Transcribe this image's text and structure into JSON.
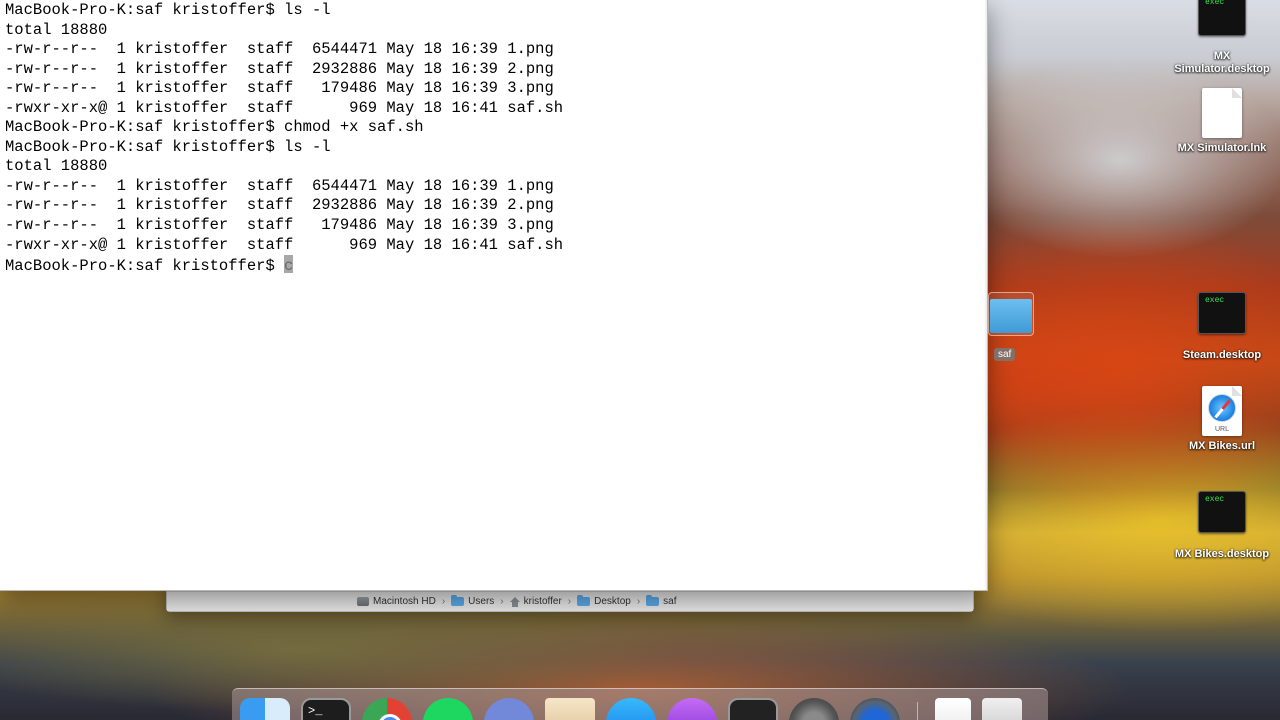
{
  "terminal": {
    "lines": [
      "MacBook-Pro-K:saf kristoffer$ ls -l",
      "total 18880",
      "-rw-r--r--  1 kristoffer  staff  6544471 May 18 16:39 1.png",
      "-rw-r--r--  1 kristoffer  staff  2932886 May 18 16:39 2.png",
      "-rw-r--r--  1 kristoffer  staff   179486 May 18 16:39 3.png",
      "-rwxr-xr-x@ 1 kristoffer  staff      969 May 18 16:41 saf.sh",
      "MacBook-Pro-K:saf kristoffer$ chmod +x saf.sh",
      "MacBook-Pro-K:saf kristoffer$ ls -l",
      "total 18880",
      "-rw-r--r--  1 kristoffer  staff  6544471 May 18 16:39 1.png",
      "-rw-r--r--  1 kristoffer  staff  2932886 May 18 16:39 2.png",
      "-rw-r--r--  1 kristoffer  staff   179486 May 18 16:39 3.png",
      "-rwxr-xr-x@ 1 kristoffer  staff      969 May 18 16:41 saf.sh",
      "MacBook-Pro-K:saf kristoffer$ c"
    ]
  },
  "finder": {
    "path": [
      "Macintosh HD",
      "Users",
      "kristoffer",
      "Desktop",
      "saf"
    ]
  },
  "desktop": {
    "icons": [
      {
        "label": "MX Simulator.desktop",
        "kind": "exec",
        "icon_text": "exec"
      },
      {
        "label": "MX Simulator.lnk",
        "kind": "document"
      },
      {
        "label": "Steam.desktop",
        "kind": "exec",
        "icon_text": "exec"
      },
      {
        "label": "MX Bikes.url",
        "kind": "url",
        "icon_text": "URL"
      },
      {
        "label": "MX Bikes.desktop",
        "kind": "exec",
        "icon_text": "exec"
      }
    ],
    "folder_label": "saf"
  },
  "dock": {
    "items": [
      "finder-icon",
      "terminal-icon",
      "chrome-icon",
      "spotify-icon",
      "discord-icon",
      "preview-icon",
      "app-store-icon",
      "podcasts-icon",
      "activity-monitor-icon",
      "system-preferences-icon",
      "quicktime-icon",
      "documents-icon",
      "trash-icon"
    ],
    "terminal_glyph": ">_"
  }
}
